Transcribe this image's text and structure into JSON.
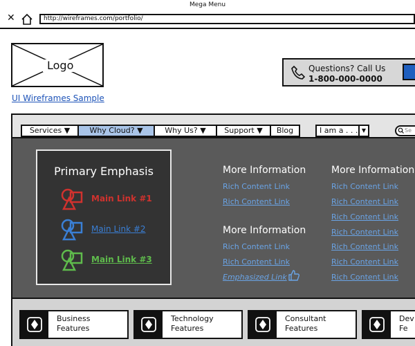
{
  "browser": {
    "window_title": "Mega Menu",
    "url": "http://wireframes.com/portfolio/"
  },
  "header": {
    "logo_text": "Logo",
    "sample_link": "UI Wireframes Sample",
    "call_line1": "Questions? Call Us",
    "call_line2": "1-800-000-0000"
  },
  "nav": {
    "items": [
      {
        "label": "Services"
      },
      {
        "label": "Why Cloud?"
      },
      {
        "label": "Why Us?"
      },
      {
        "label": "Support"
      },
      {
        "label": "Blog"
      }
    ],
    "dropdown_value": "I am a . . .",
    "search_placeholder": "Se"
  },
  "mega": {
    "primary_title": "Primary Emphasis",
    "main_links": [
      "Main Link #1",
      "Main Link #2",
      "Main Link #3"
    ],
    "col1": {
      "heading1": "More Information",
      "links1": [
        "Rich Content Link",
        "Rich Content Link"
      ],
      "heading2": "More Information",
      "links2": [
        "Rich Content Link",
        "Rich Content Link"
      ],
      "emphasized": "Emphasized Link"
    },
    "col2": {
      "heading": "More Information",
      "links": [
        "Rich Content Link",
        "Rich Content Link",
        "Rich Content Link",
        "Rich Content Link",
        "Rich Content Link",
        "Rich Content Link",
        "Rich Content Link"
      ]
    }
  },
  "features": [
    {
      "line1": "Business",
      "line2": "Features"
    },
    {
      "line1": "Technology",
      "line2": "Features"
    },
    {
      "line1": "Consultant",
      "line2": "Features"
    },
    {
      "line1": "Dev",
      "line2": "Fe"
    }
  ],
  "colors": {
    "nav_active": "#a9c4e8",
    "panel_bg": "#333333",
    "link_blue": "#6aa4e6",
    "red": "#d0322e",
    "green": "#5fbb4c"
  }
}
